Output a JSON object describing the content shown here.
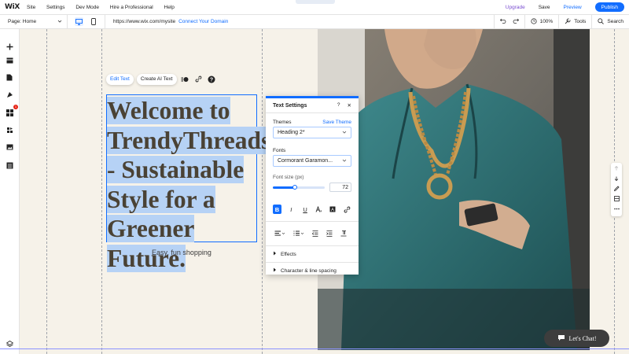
{
  "app": {
    "logo": "WiX"
  },
  "menu": [
    "Site",
    "Settings",
    "Dev Mode",
    "Hire a Professional",
    "Help"
  ],
  "actions": {
    "upgrade": "Upgrade",
    "save": "Save",
    "preview": "Preview",
    "publish": "Publish"
  },
  "toolbar": {
    "page_label": "Page: Home",
    "url": "https://www.wix.com/mysite",
    "connect": "Connect Your Domain",
    "zoom": "100%",
    "tools": "Tools",
    "search": "Search"
  },
  "leftbar": {
    "badge": "1"
  },
  "edit_tools": {
    "edit_text": "Edit Text",
    "create_ai_text": "Create AI Text"
  },
  "content": {
    "heading": "Welcome to TrendyThreads - Sustainable Style for a Greener Future.",
    "heading_lines": [
      "Welcome to",
      "TrendyThreads",
      "- Sustainable",
      "Style for a",
      "Greener Future."
    ],
    "subtitle": "Easy, fun shopping"
  },
  "text_settings": {
    "title": "Text Settings",
    "themes_label": "Themes",
    "save_theme": "Save Theme",
    "theme_value": "Heading 2*",
    "fonts_label": "Fonts",
    "font_value": "Cormorant Garamon...",
    "font_size_label": "Font size (px)",
    "font_size": "72",
    "font_size_fraction": 0.42,
    "effects": "Effects",
    "spacing": "Character & line spacing"
  },
  "chat": {
    "label": "Let's Chat!"
  },
  "colors": {
    "accent": "#116dff",
    "upgrade": "#7a4ed1",
    "canvas": "#f6f2e9",
    "heading_text": "#4a4235",
    "selection": "#b6d2f5"
  }
}
